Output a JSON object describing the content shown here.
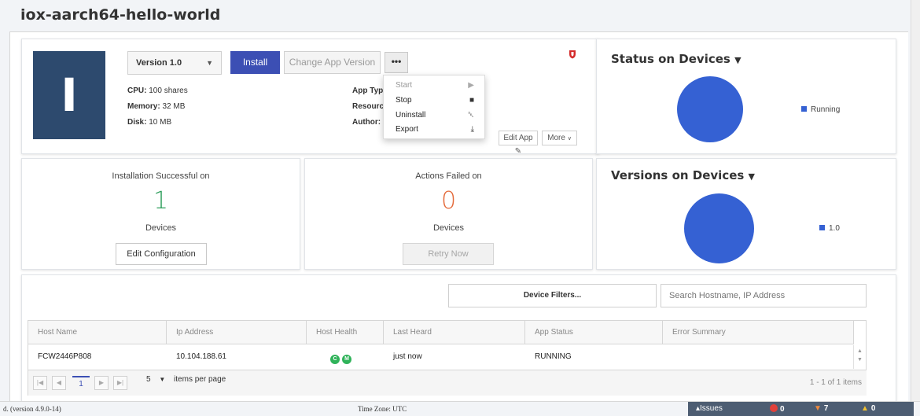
{
  "page": {
    "title": "iox-aarch64-hello-world"
  },
  "app": {
    "tile_letter": "I",
    "version_select": "Version 1.0",
    "install_label": "Install",
    "change_version_label": "Change App Version",
    "more_dots": "•••",
    "specs": [
      {
        "label": "CPU:",
        "value": "100 shares"
      },
      {
        "label": "Memory:",
        "value": "32 MB"
      },
      {
        "label": "Disk:",
        "value": "10 MB"
      }
    ],
    "meta_labels": [
      "App Typ",
      "Resource",
      "Author:"
    ],
    "edit_app_label": "Edit App",
    "more_label": "More",
    "menu": [
      {
        "label": "Start",
        "icon": "play-icon",
        "glyph": "▶",
        "disabled": true
      },
      {
        "label": "Stop",
        "icon": "stop-icon",
        "glyph": "■",
        "disabled": false
      },
      {
        "label": "Uninstall",
        "icon": "trash-icon",
        "glyph": "␡",
        "disabled": false
      },
      {
        "label": "Export",
        "icon": "download-icon",
        "glyph": "⤓",
        "disabled": false
      }
    ]
  },
  "status_card": {
    "title": "Status on Devices",
    "chart_data": {
      "type": "pie",
      "categories": [
        "Running"
      ],
      "values": [
        1
      ],
      "colors": [
        "#3561d3"
      ],
      "legend": "right"
    }
  },
  "versions_card": {
    "title": "Versions on Devices",
    "chart_data": {
      "type": "pie",
      "categories": [
        "1.0"
      ],
      "values": [
        1
      ],
      "colors": [
        "#3561d3"
      ],
      "legend": "right"
    }
  },
  "install_card": {
    "label": "Installation Successful on",
    "count": "1",
    "unit": "Devices",
    "button": "Edit Configuration",
    "count_color": "#2e9e5c"
  },
  "failed_card": {
    "label": "Actions Failed on",
    "count": "0",
    "unit": "Devices",
    "button": "Retry Now",
    "count_color": "#e46a3a"
  },
  "filters": {
    "device_filters_label": "Device Filters...",
    "search_placeholder": "Search Hostname, IP Address"
  },
  "table": {
    "columns": [
      "Host Name",
      "Ip Address",
      "Host Health",
      "Last Heard",
      "App Status",
      "Error Summary"
    ],
    "rows": [
      {
        "host": "FCW2446P808",
        "ip": "10.104.188.61",
        "health": [
          "C",
          "M"
        ],
        "last_heard": "just now",
        "status": "RUNNING",
        "error": ""
      }
    ]
  },
  "pager": {
    "page": "1",
    "page_size": "5",
    "page_size_label": "items per page",
    "info": "1 - 1 of 1 items"
  },
  "footer": {
    "version": "d. (version 4.9.0-14)",
    "timezone": "Time Zone: UTC",
    "issues_label": "▴Issues",
    "errors": "0",
    "warnings": "7",
    "alerts": "0"
  }
}
